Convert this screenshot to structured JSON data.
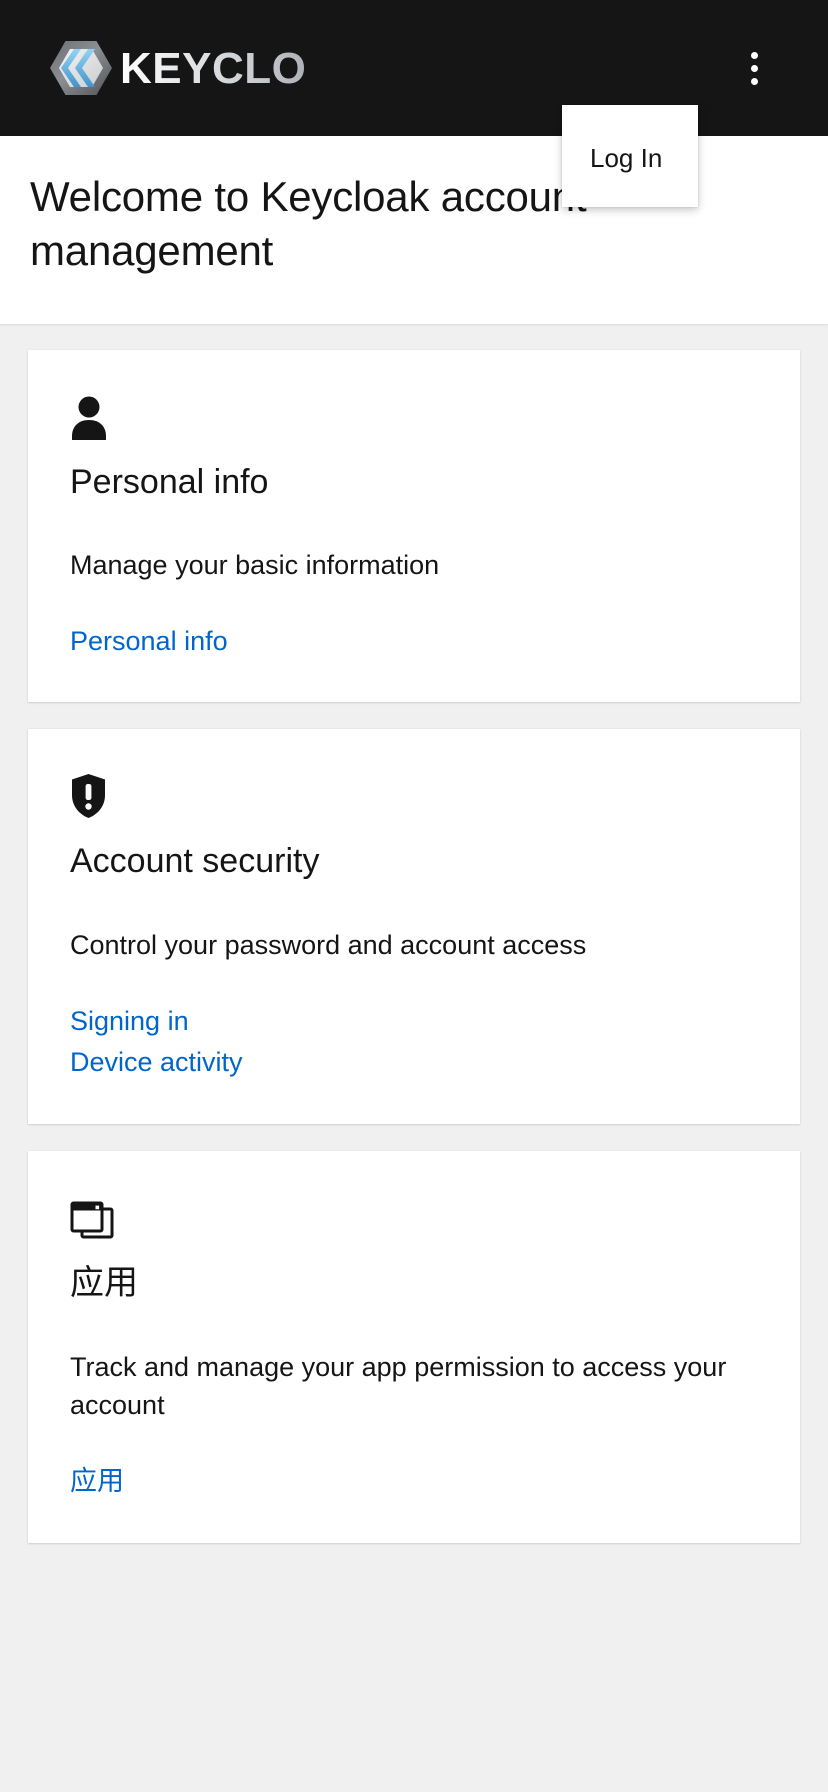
{
  "masthead": {
    "brand_name": "KEYCLOAK",
    "brand_logo_icon": "keycloak-logo-icon",
    "kebab_icon": "kebab-menu-icon",
    "background_color": "#151515"
  },
  "dropdown": {
    "visible": true,
    "items": [
      {
        "label": "Log In",
        "name": "menu-item-log-in"
      }
    ]
  },
  "page": {
    "title": "Welcome to Keycloak account management",
    "background_color": "#f0f0f0",
    "link_color": "#0066cc"
  },
  "cards": [
    {
      "icon": "user-icon",
      "title": "Personal info",
      "description": "Manage your basic information",
      "links": [
        {
          "label": "Personal info",
          "name": "card-link-personal-info"
        }
      ]
    },
    {
      "icon": "shield-exclamation-icon",
      "title": "Account security",
      "description": "Control your password and account access",
      "links": [
        {
          "label": "Signing in",
          "name": "card-link-signing-in"
        },
        {
          "label": "Device activity",
          "name": "card-link-device-activity"
        }
      ]
    },
    {
      "icon": "applications-windows-icon",
      "title": "应用",
      "description": "Track and manage your app permission to access your account",
      "links": [
        {
          "label": "应用",
          "name": "card-link-applications"
        }
      ]
    }
  ]
}
